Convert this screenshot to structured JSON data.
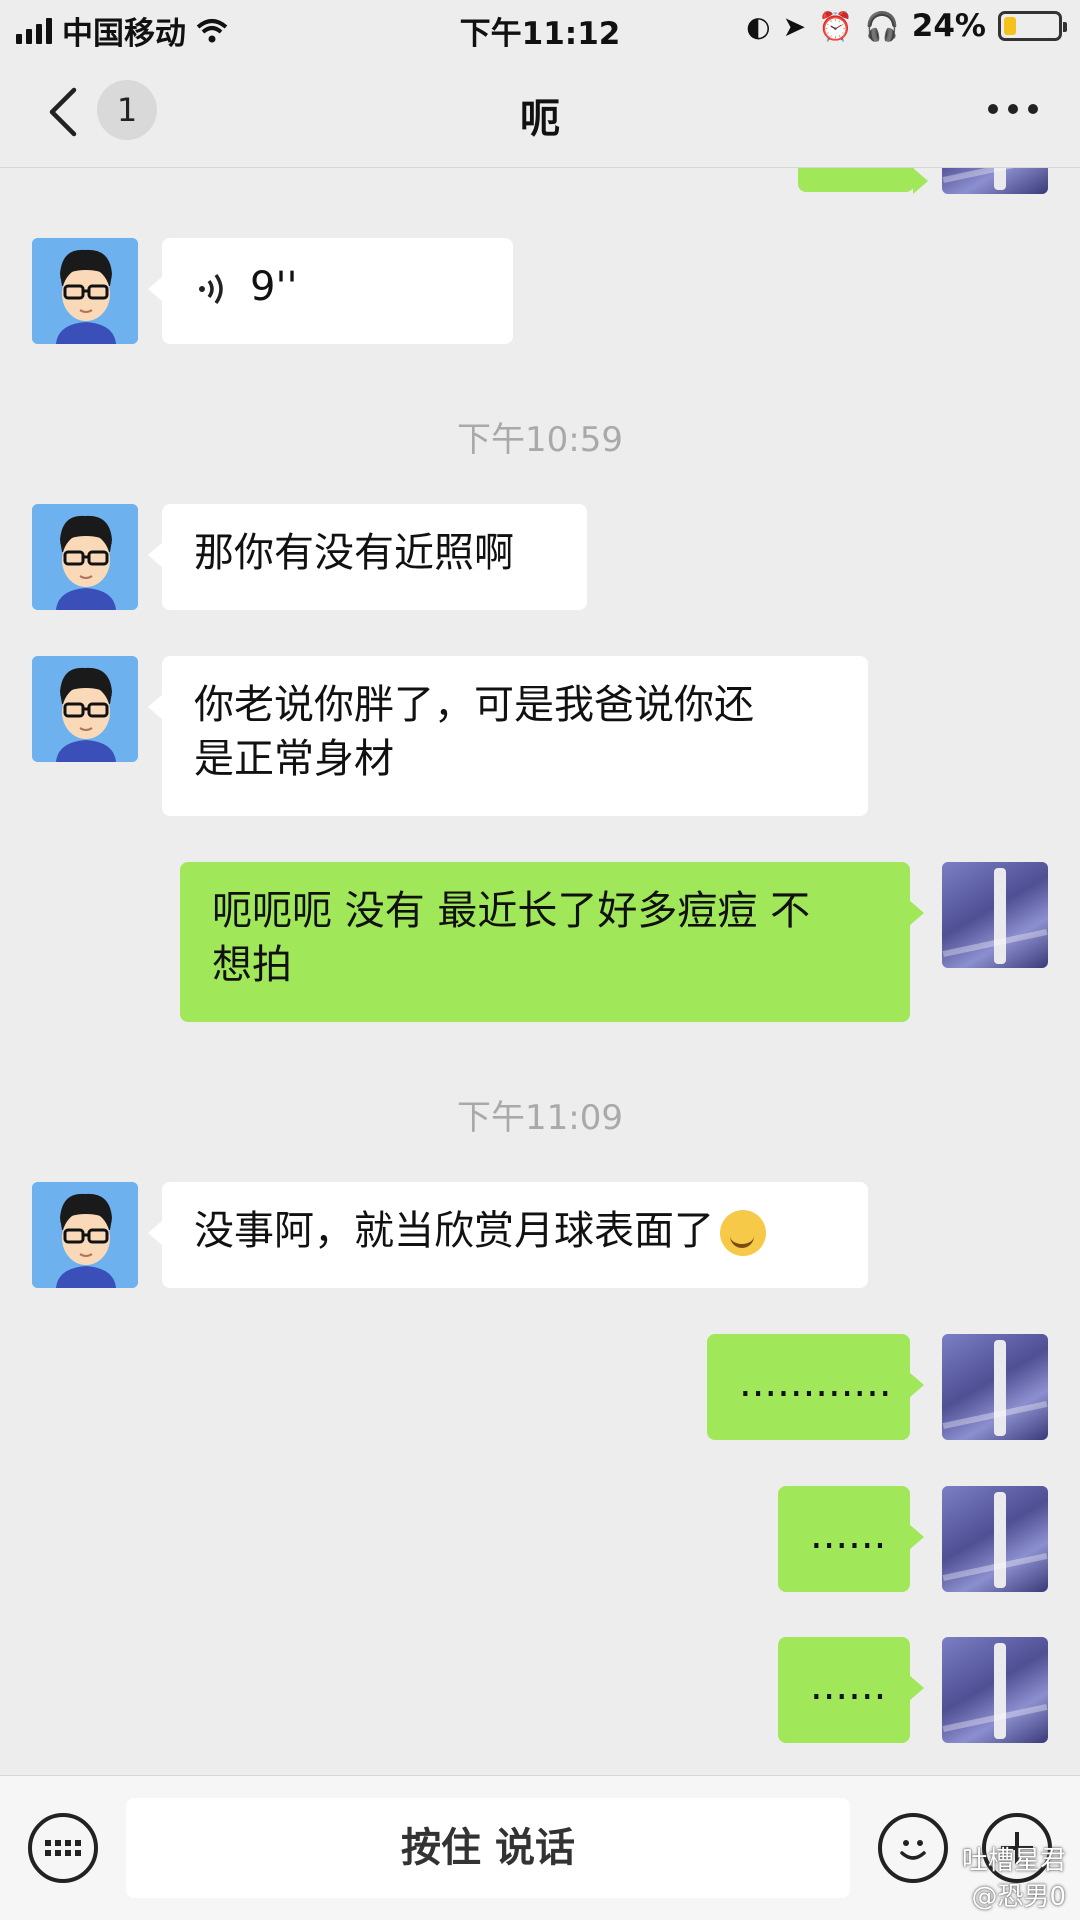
{
  "status_bar": {
    "carrier": "中国移动",
    "time": "下午11:12",
    "battery": "24%",
    "battery_level": 0.24
  },
  "nav": {
    "unread_count": "1",
    "title": "呃"
  },
  "messages": [
    {
      "side": "left",
      "type": "voice",
      "text": "9''"
    },
    {
      "type": "timestamp",
      "text": "下午10:59"
    },
    {
      "side": "left",
      "type": "text",
      "text": "那你有没有近照啊"
    },
    {
      "side": "left",
      "type": "text",
      "text_line1": "你老说你胖了，可是我爸说你还",
      "text_line2": "是正常身材"
    },
    {
      "side": "right",
      "type": "text",
      "text_line1": "呃呃呃 没有 最近长了好多痘痘 不",
      "text_line2": "想拍"
    },
    {
      "type": "timestamp",
      "text": "下午11:09"
    },
    {
      "side": "left",
      "type": "text",
      "text": "没事阿，就当欣赏月球表面了",
      "emoji": "smirk-face"
    },
    {
      "side": "right",
      "type": "text",
      "text": "............"
    },
    {
      "side": "right",
      "type": "text",
      "text": "......"
    },
    {
      "side": "right",
      "type": "text",
      "text": "......"
    }
  ],
  "toolbar": {
    "hold_to_talk": "按住 说话"
  },
  "watermark": {
    "line1": "吐槽星君",
    "line2": "@恐男0"
  },
  "colors": {
    "background": "#ededed",
    "bubble_self": "#a0e75a",
    "bubble_other": "#ffffff",
    "timestamp": "#a9a9a9"
  }
}
